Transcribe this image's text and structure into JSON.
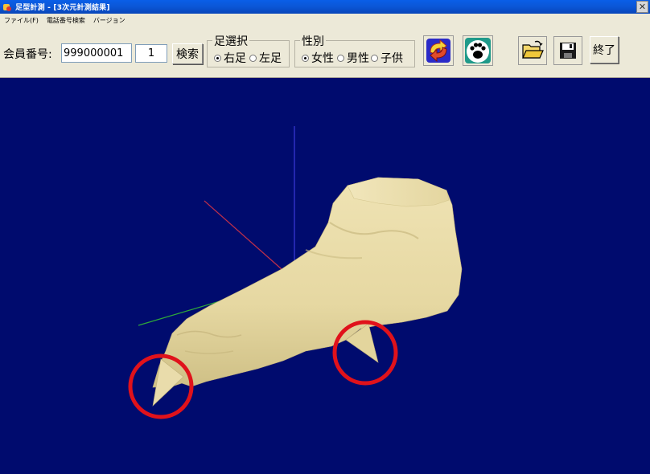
{
  "window": {
    "title": "足型計測 - [3次元計測結果]",
    "close_glyph": "✕"
  },
  "menu": [
    {
      "label": "ファイル(F)"
    },
    {
      "label": "電話番号検索"
    },
    {
      "label": "バージョン"
    }
  ],
  "toolbar": {
    "member_label": "会員番号:",
    "member_number": "999000001",
    "sequence": "1",
    "search_label": "検索",
    "foot_group": {
      "title": "足選択",
      "options": [
        {
          "label": "右足",
          "selected": true
        },
        {
          "label": "左足",
          "selected": false
        }
      ]
    },
    "gender_group": {
      "title": "性別",
      "options": [
        {
          "label": "女性",
          "selected": true
        },
        {
          "label": "男性",
          "selected": false
        },
        {
          "label": "子供",
          "selected": false
        }
      ]
    },
    "icons": {
      "rotate": "rotate-arrows-icon",
      "footprint": "paw-print-icon",
      "open": "folder-open-icon",
      "save": "floppy-disk-icon"
    },
    "exit_label": "終了"
  },
  "viewport": {
    "background": "#000b6e",
    "foot_color": "#e8dcaa",
    "highlight_color": "#e0121b",
    "axis_colors": {
      "x": "#c0304a",
      "y": "#3a3ad8",
      "z": "#2ea83a"
    }
  }
}
